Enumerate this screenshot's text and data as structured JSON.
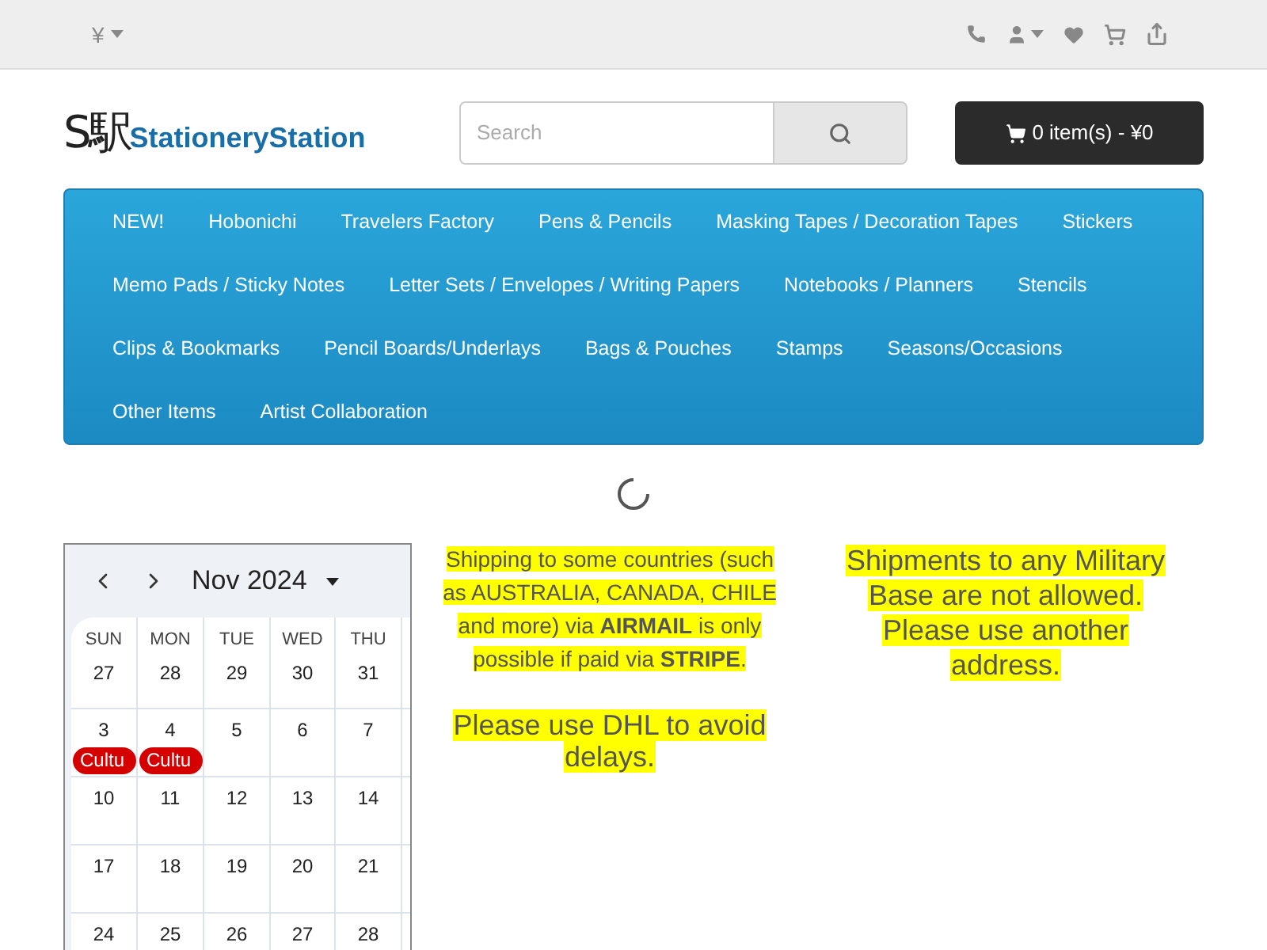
{
  "topbar": {
    "currency": "¥"
  },
  "header": {
    "logo_mark": "S駅",
    "logo_text": "StationeryStation",
    "search": {
      "placeholder": "Search"
    },
    "cart": "0 item(s) - ¥0"
  },
  "menu": [
    {
      "label": "NEW!"
    },
    {
      "label": "Hobonichi"
    },
    {
      "label": "Travelers Factory"
    },
    {
      "label": "Pens & Pencils"
    },
    {
      "label": "Masking Tapes / Decoration Tapes"
    },
    {
      "label": "Stickers"
    },
    {
      "label": "Memo Pads / Sticky Notes"
    },
    {
      "label": "Letter Sets / Envelopes / Writing Papers"
    },
    {
      "label": "Notebooks / Planners"
    },
    {
      "label": "Stencils"
    },
    {
      "label": "Clips & Bookmarks"
    },
    {
      "label": "Pencil Boards/Underlays"
    },
    {
      "label": "Bags & Pouches"
    },
    {
      "label": "Stamps"
    },
    {
      "label": "Seasons/Occasions"
    },
    {
      "label": "Other Items"
    },
    {
      "label": "Artist Collaboration"
    }
  ],
  "calendar": {
    "month": "Nov 2024",
    "weekdays": [
      "SUN",
      "MON",
      "TUE",
      "WED",
      "THU"
    ],
    "weeks": [
      [
        {
          "day": "27"
        },
        {
          "day": "28"
        },
        {
          "day": "29"
        },
        {
          "day": "30"
        },
        {
          "day": "31"
        }
      ],
      [
        {
          "day": "3",
          "events": [
            {
              "label": "Cultu",
              "color": "#d50000"
            }
          ]
        },
        {
          "day": "4",
          "events": [
            {
              "label": "Cultu",
              "color": "#d50000"
            }
          ]
        },
        {
          "day": "5"
        },
        {
          "day": "6"
        },
        {
          "day": "7"
        }
      ],
      [
        {
          "day": "10"
        },
        {
          "day": "11"
        },
        {
          "day": "12"
        },
        {
          "day": "13"
        },
        {
          "day": "14"
        }
      ],
      [
        {
          "day": "17"
        },
        {
          "day": "18"
        },
        {
          "day": "19"
        },
        {
          "day": "20"
        },
        {
          "day": "21"
        }
      ],
      [
        {
          "day": "24"
        },
        {
          "day": "25"
        },
        {
          "day": "26"
        },
        {
          "day": "27"
        },
        {
          "day": "28"
        }
      ]
    ]
  },
  "notice_left": [
    "Shipping to some countries (such as AUSTRALIA, CANADA, CHILE and more) via **AIRMAIL** is only possible if paid via **STRIPE**.",
    "Please use DHL to avoid delays."
  ],
  "notice_right": "Shipments to any Military Base are not allowed. Please use another address."
}
